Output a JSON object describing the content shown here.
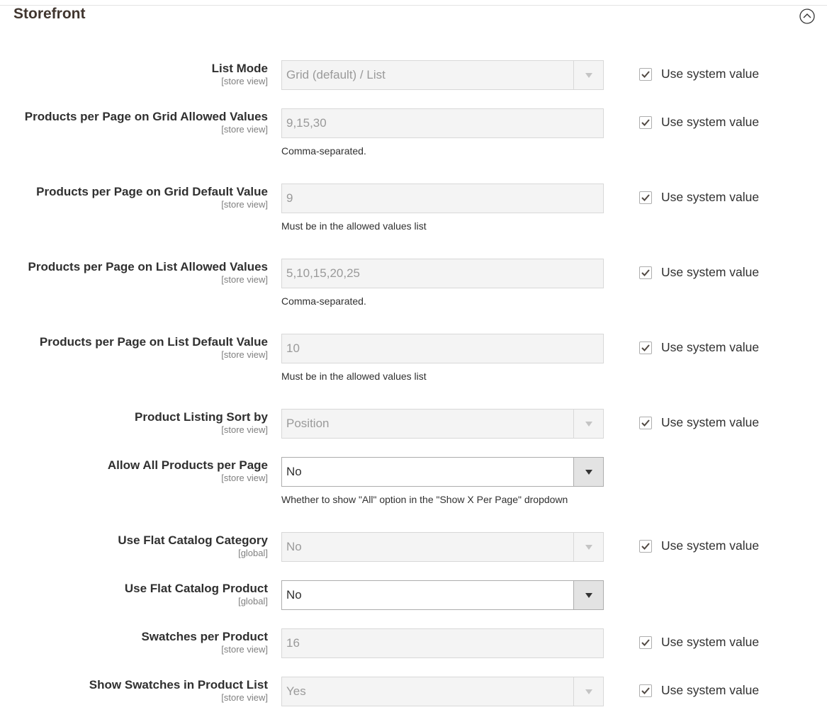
{
  "section": {
    "title": "Storefront"
  },
  "use_system_label": "Use system value",
  "fields": [
    {
      "label": "List Mode",
      "scope": "[store view]",
      "value": "Grid (default) / List"
    },
    {
      "label": "Products per Page on Grid Allowed Values",
      "scope": "[store view]",
      "value": "9,15,30",
      "note": "Comma-separated."
    },
    {
      "label": "Products per Page on Grid Default Value",
      "scope": "[store view]",
      "value": "9",
      "note": "Must be in the allowed values list"
    },
    {
      "label": "Products per Page on List Allowed Values",
      "scope": "[store view]",
      "value": "5,10,15,20,25",
      "note": "Comma-separated."
    },
    {
      "label": "Products per Page on List Default Value",
      "scope": "[store view]",
      "value": "10",
      "note": "Must be in the allowed values list"
    },
    {
      "label": "Product Listing Sort by",
      "scope": "[store view]",
      "value": "Position"
    },
    {
      "label": "Allow All Products per Page",
      "scope": "[store view]",
      "value": "No",
      "note": "Whether to show \"All\" option in the \"Show X Per Page\" dropdown"
    },
    {
      "label": "Use Flat Catalog Category",
      "scope": "[global]",
      "value": "No"
    },
    {
      "label": "Use Flat Catalog Product",
      "scope": "[global]",
      "value": "No"
    },
    {
      "label": "Swatches per Product",
      "scope": "[store view]",
      "value": "16"
    },
    {
      "label": "Show Swatches in Product List",
      "scope": "[store view]",
      "value": "Yes"
    }
  ]
}
